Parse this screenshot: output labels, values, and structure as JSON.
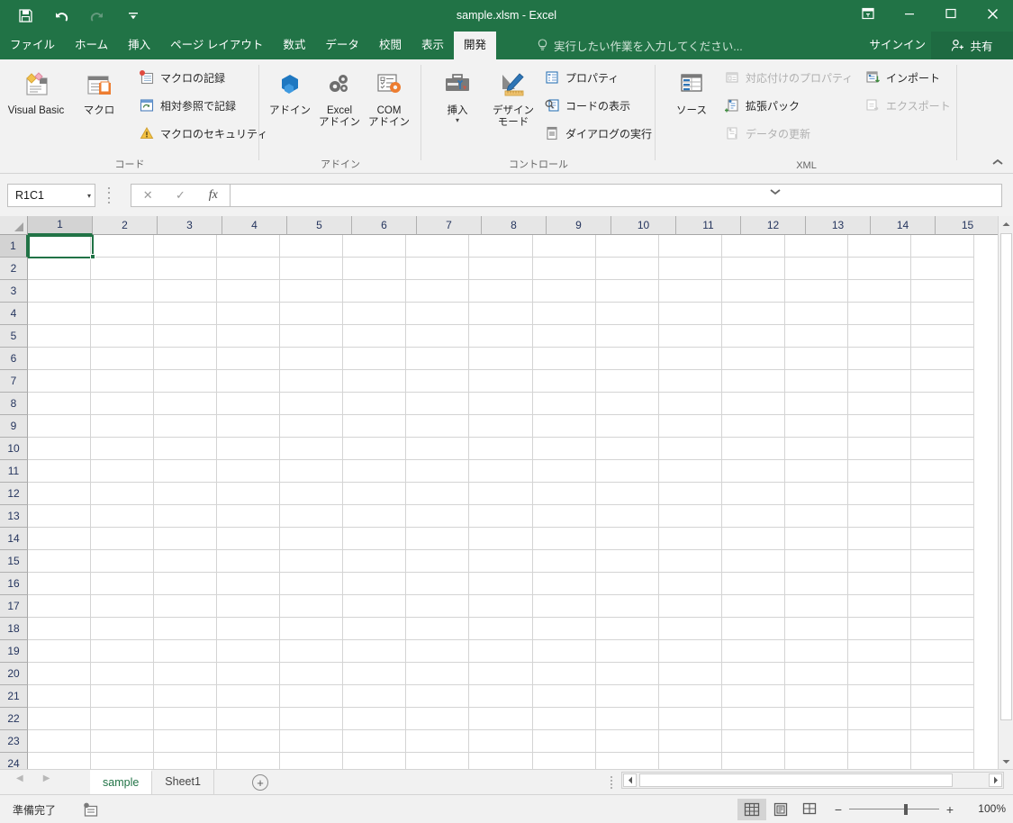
{
  "window": {
    "title": "sample.xlsm - Excel",
    "quick_access": [
      {
        "name": "save-button",
        "icon": "save-icon"
      },
      {
        "name": "undo-button",
        "icon": "undo-icon"
      },
      {
        "name": "redo-button",
        "icon": "redo-icon"
      },
      {
        "name": "customize-qat-button",
        "icon": "chevron-down-icon"
      }
    ],
    "controls": [
      {
        "name": "ribbon-display-options-button",
        "icon": "ribbon-display-icon"
      },
      {
        "name": "minimize-button",
        "icon": "minimize-icon"
      },
      {
        "name": "maximize-button",
        "icon": "maximize-icon"
      },
      {
        "name": "close-button",
        "icon": "close-icon"
      }
    ],
    "signin_label": "サインイン",
    "share_label": "共有",
    "accent_color": "#217346"
  },
  "ribbon_tabs": [
    {
      "label": "ファイル",
      "active": false
    },
    {
      "label": "ホーム",
      "active": false
    },
    {
      "label": "挿入",
      "active": false
    },
    {
      "label": "ページ レイアウト",
      "active": false
    },
    {
      "label": "数式",
      "active": false
    },
    {
      "label": "データ",
      "active": false
    },
    {
      "label": "校閲",
      "active": false
    },
    {
      "label": "表示",
      "active": false
    },
    {
      "label": "開発",
      "active": true
    }
  ],
  "tell_me": {
    "placeholder": "実行したい作業を入力してください..."
  },
  "ribbon": {
    "groups": [
      {
        "label": "コード",
        "big_buttons": [
          {
            "label": "Visual Basic",
            "icon": "visual-basic-icon"
          },
          {
            "label": "マクロ",
            "icon": "macro-icon"
          }
        ],
        "small_buttons": [
          {
            "label": "マクロの記録",
            "icon": "record-macro-icon",
            "disabled": false
          },
          {
            "label": "相対参照で記録",
            "icon": "relative-reference-icon",
            "disabled": false
          },
          {
            "label": "マクロのセキュリティ",
            "icon": "macro-security-icon",
            "disabled": false
          }
        ]
      },
      {
        "label": "アドイン",
        "big_buttons": [
          {
            "label": "アドイン",
            "icon": "addins-icon"
          },
          {
            "label": "Excel\nアドイン",
            "icon": "excel-addins-icon"
          },
          {
            "label": "COM\nアドイン",
            "icon": "com-addins-icon"
          }
        ],
        "small_buttons": []
      },
      {
        "label": "コントロール",
        "big_buttons": [
          {
            "label": "挿入",
            "icon": "insert-control-icon",
            "has_caret": true
          },
          {
            "label": "デザイン\nモード",
            "icon": "design-mode-icon"
          }
        ],
        "small_buttons": [
          {
            "label": "プロパティ",
            "icon": "properties-icon",
            "disabled": false
          },
          {
            "label": "コードの表示",
            "icon": "view-code-icon",
            "disabled": false
          },
          {
            "label": "ダイアログの実行",
            "icon": "run-dialog-icon",
            "disabled": false
          }
        ]
      },
      {
        "label": "XML",
        "big_buttons": [
          {
            "label": "ソース",
            "icon": "xml-source-icon"
          }
        ],
        "small_buttons": [
          {
            "label": "対応付けのプロパティ",
            "icon": "map-properties-icon",
            "disabled": true
          },
          {
            "label": "拡張パック",
            "icon": "expansion-packs-icon",
            "disabled": false
          },
          {
            "label": "データの更新",
            "icon": "refresh-data-icon",
            "disabled": true
          },
          {
            "label": "インポート",
            "icon": "import-icon",
            "disabled": false
          },
          {
            "label": "エクスポート",
            "icon": "export-icon",
            "disabled": true
          }
        ]
      }
    ]
  },
  "formula_bar": {
    "name_box_value": "R1C1",
    "cancel_icon": "cancel-icon",
    "enter_icon": "check-icon",
    "function_icon": "fx-icon",
    "input_value": ""
  },
  "grid": {
    "reference_style": "R1C1",
    "column_headers": [
      "1",
      "2",
      "3",
      "4",
      "5",
      "6",
      "7",
      "8",
      "9",
      "10",
      "11",
      "12",
      "13",
      "14",
      "15"
    ],
    "row_headers": [
      "1",
      "2",
      "3",
      "4",
      "5",
      "6",
      "7",
      "8",
      "9",
      "10",
      "11",
      "12",
      "13",
      "14",
      "15",
      "16",
      "17",
      "18",
      "19",
      "20",
      "21",
      "22",
      "23",
      "24"
    ],
    "selected_cell": "R1C1",
    "selected_column_index": 0,
    "selected_row_index": 0,
    "cell_values": []
  },
  "sheet_tabs": {
    "nav_prev_icon": "nav-prev-icon",
    "nav_next_icon": "nav-next-icon",
    "tabs": [
      {
        "label": "sample",
        "active": true
      },
      {
        "label": "Sheet1",
        "active": false
      }
    ],
    "add_sheet_label": "+"
  },
  "status_bar": {
    "status_text": "準備完了",
    "record_macro_icon": "record-macro-status-icon",
    "view_buttons": [
      {
        "name": "normal-view-button",
        "icon": "normal-view-icon",
        "active": true
      },
      {
        "name": "page-layout-view-button",
        "icon": "page-layout-view-icon",
        "active": false
      },
      {
        "name": "page-break-preview-button",
        "icon": "page-break-preview-icon",
        "active": false
      }
    ],
    "zoom_out_label": "−",
    "zoom_in_label": "+",
    "zoom_value": "100%"
  }
}
